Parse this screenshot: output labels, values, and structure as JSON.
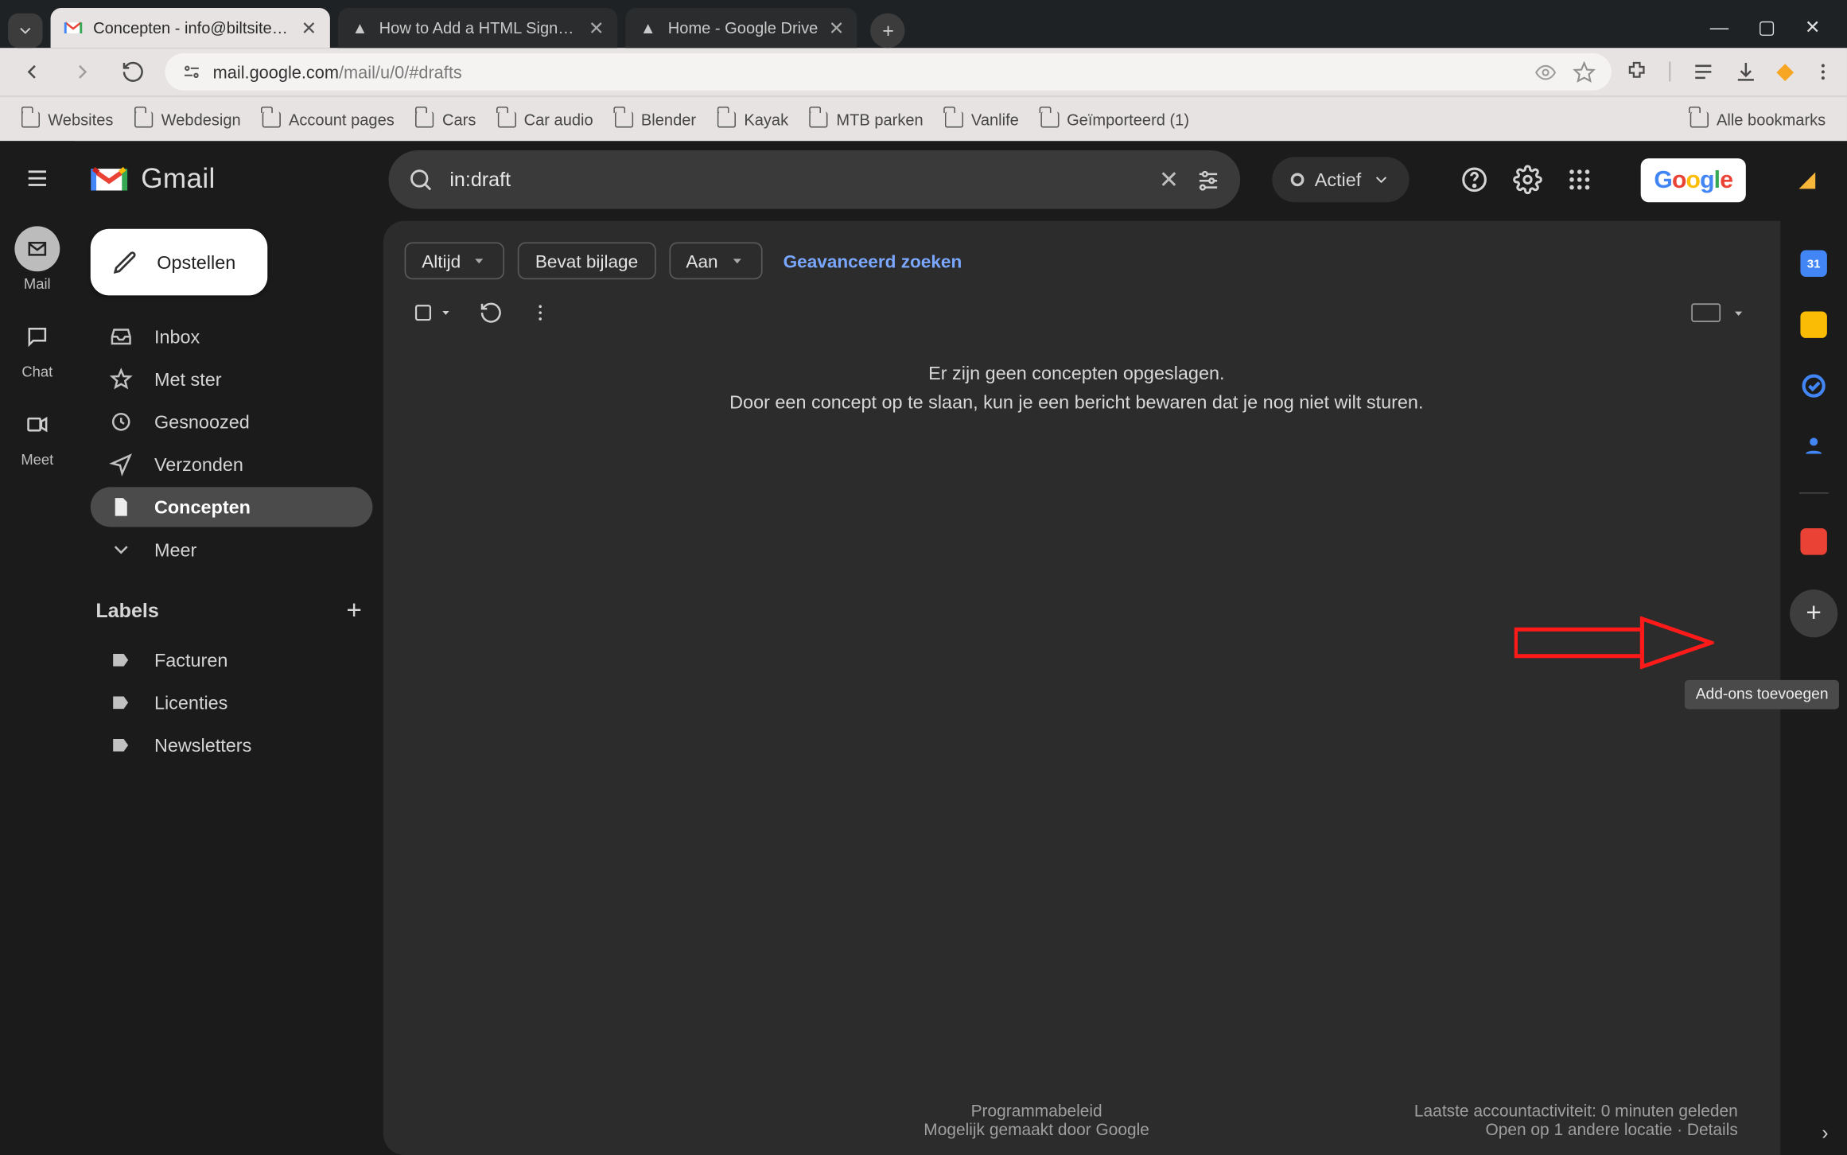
{
  "browser": {
    "tabs": [
      {
        "title": "Concepten - info@biltsite.com",
        "active": true
      },
      {
        "title": "How to Add a HTML Signature",
        "active": false
      },
      {
        "title": "Home - Google Drive",
        "active": false
      }
    ],
    "url_host": "mail.google.com",
    "url_path": "/mail/u/0/#drafts",
    "bookmarks": [
      "Websites",
      "Webdesign",
      "Account pages",
      "Cars",
      "Car audio",
      "Blender",
      "Kayak",
      "MTB parken",
      "Vanlife",
      "Geïmporteerd (1)"
    ],
    "all_bookmarks": "Alle bookmarks"
  },
  "rail": {
    "mail": "Mail",
    "chat": "Chat",
    "meet": "Meet"
  },
  "header": {
    "brand": "Gmail",
    "search_value": "in:draft",
    "status": "Actief",
    "google": "Google"
  },
  "sidebar": {
    "compose": "Opstellen",
    "nav": {
      "inbox": "Inbox",
      "starred": "Met ster",
      "snoozed": "Gesnoozed",
      "sent": "Verzonden",
      "drafts": "Concepten",
      "more": "Meer"
    },
    "labels_header": "Labels",
    "labels": [
      "Facturen",
      "Licenties",
      "Newsletters"
    ]
  },
  "content": {
    "chips": {
      "always": "Altijd",
      "has_attachment": "Bevat bijlage",
      "to": "Aan"
    },
    "advanced": "Geavanceerd zoeken",
    "empty_line1": "Er zijn geen concepten opgeslagen.",
    "empty_line2": "Door een concept op te slaan, kun je een bericht bewaren dat je nog niet wilt sturen.",
    "footer_center1": "Programmabeleid",
    "footer_center2": "Mogelijk gemaakt door Google",
    "footer_right1": "Laatste accountactiviteit: 0 minuten geleden",
    "footer_right2": "Open op 1 andere locatie · Details"
  },
  "right_rail": {
    "tooltip": "Add-ons toevoegen"
  }
}
